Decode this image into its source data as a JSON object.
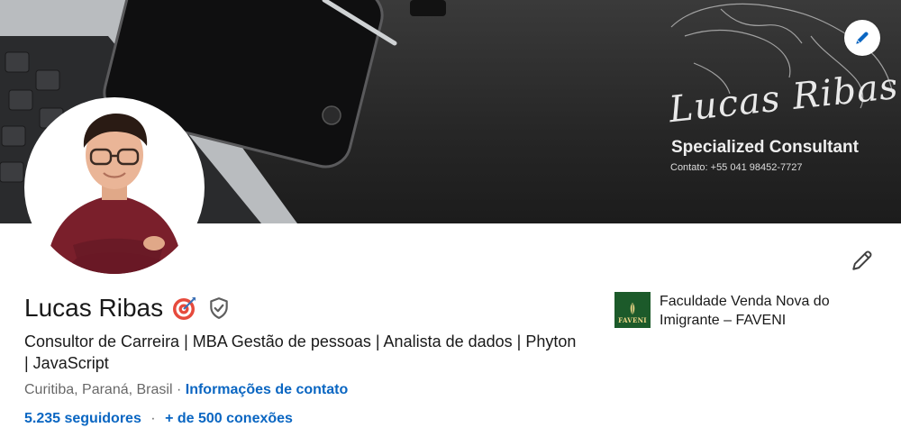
{
  "banner": {
    "name": "Lucas Ribas",
    "tagline": "Specialized Consultant",
    "contact": "Contato: +55 041 98452-7727"
  },
  "profile": {
    "name": "Lucas Ribas",
    "headline": "Consultor de Carreira | MBA Gestão de pessoas | Analista de dados | Phyton | JavaScript",
    "location": "Curitiba, Paraná, Brasil",
    "separator": "·",
    "contact_info_label": "Informações de contato",
    "followers": "5.235 seguidores",
    "connections": "+ de 500 conexões",
    "network_dot": "·"
  },
  "education": {
    "logo_text": "FAVENI",
    "name": "Faculdade Venda Nova do Imigrante – FAVENI"
  },
  "colors": {
    "link": "#0a66c2",
    "banner_bg": "#262626",
    "edu_logo_bg": "#1c5a2a"
  },
  "icons": {
    "banner_edit": "pencil-icon",
    "profile_edit": "pencil-icon",
    "badge": "target-icon",
    "verification": "shield-check-icon"
  }
}
